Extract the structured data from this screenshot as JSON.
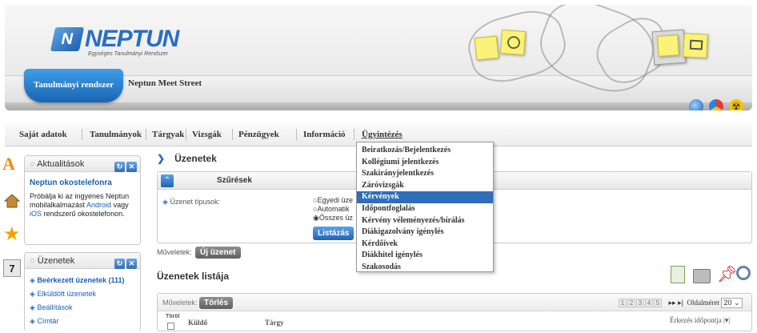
{
  "header": {
    "logo_name": "NEPTUN",
    "logo_sub": "Egységes Tanulmányi Rendszer",
    "tab_active": "Tanulmányi rendszer",
    "tab_other": "Neptun Meet Street"
  },
  "menu": {
    "items": [
      "Saját adatok",
      "Tanulmányok",
      "Tárgyak",
      "Vizsgák",
      "Pénzügyek",
      "Információ",
      "Ügyintézés"
    ]
  },
  "dropdown": {
    "items": [
      "Beiratkozás/Bejelentkezés",
      "Kollégiumi jelentkezés",
      "Szakirányjelentkezés",
      "Záróvizsgák",
      "Kérvények",
      "Időpontfoglalás",
      "Kérvény véleményezés/bírálás",
      "Diákigazolvány igénylés",
      "Kérdőívek",
      "Diákhitel igénylés",
      "Szakosodás"
    ],
    "active_index": 4
  },
  "aktualitasok": {
    "title": "Aktualitások",
    "news_title": "Neptun okostelefonra",
    "text_1": "Próbálja ki az ingyenes Neptun mobilalkalmazást ",
    "link_android": "Android",
    "text_2": " vagy ",
    "link_ios": "iOS",
    "text_3": " rendszerű okostelefonon."
  },
  "uzenetek_panel": {
    "title": "Üzenetek",
    "items": [
      "Beérkezett üzenetek (111)",
      "Elküldött üzenetek",
      "Beállítások",
      "Címtár"
    ]
  },
  "main": {
    "title": "Üzenetek",
    "filter_title": "Szűrések",
    "type_label": "Üzenet típusok:",
    "radio_1": "Egyedi üze",
    "radio_2": "Automatik",
    "radio_3": "Összes üz",
    "list_button": "Listázás",
    "actions_label": "Műveletek:",
    "new_message": "Új üzenet",
    "list_title": "Üzenetek listája",
    "list_actions_label": "Műveletek:",
    "delete_button": "Törlés",
    "col_delete": "Töröl",
    "col_sender": "Küldő",
    "col_subject": "Tárgy",
    "col_arrival": "Érkezés időpontja",
    "pages": [
      "1",
      "2",
      "3",
      "4",
      "5"
    ],
    "page_size_label": "Oldalméret",
    "page_size": "20"
  }
}
